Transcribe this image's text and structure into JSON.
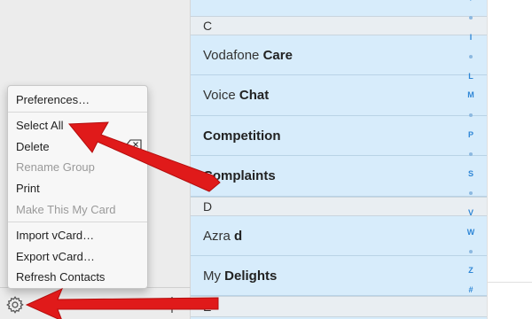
{
  "contacts": {
    "top_partial": {
      "first": "",
      "last": ""
    },
    "sections": [
      {
        "letter": "C",
        "rows": [
          {
            "first": "Vodafone",
            "last": "Care"
          },
          {
            "first": "Voice",
            "last": "Chat"
          },
          {
            "first": "",
            "last": "Competition"
          },
          {
            "first": "",
            "last": "Complaints"
          }
        ]
      },
      {
        "letter": "D",
        "rows": [
          {
            "first": "Azra",
            "last": "d"
          },
          {
            "first": "My",
            "last": "Delights"
          }
        ]
      },
      {
        "letter": "E",
        "rows": []
      }
    ]
  },
  "index_letters": [
    "I",
    "L",
    "M",
    "P",
    "S",
    "V",
    "W",
    "Z",
    "#"
  ],
  "menu": {
    "items": [
      {
        "label": "Preferences…",
        "enabled": true
      },
      {
        "label": "Select All",
        "enabled": true
      },
      {
        "label": "Delete",
        "enabled": true
      },
      {
        "label": "Rename Group",
        "enabled": false
      },
      {
        "label": "Print",
        "enabled": true
      },
      {
        "label": "Make This My Card",
        "enabled": false
      },
      {
        "label": "Import vCard…",
        "enabled": true
      },
      {
        "label": "Export vCard…",
        "enabled": true
      },
      {
        "label": "Refresh Contacts",
        "enabled": true
      }
    ]
  },
  "colors": {
    "row_bg": "#d7ecfb",
    "index_accent": "#2e86d6",
    "arrow": "#e01a1a"
  },
  "icons": {
    "gear": "gear-icon",
    "plus": "plus-icon",
    "delete": "delete-key-icon"
  }
}
